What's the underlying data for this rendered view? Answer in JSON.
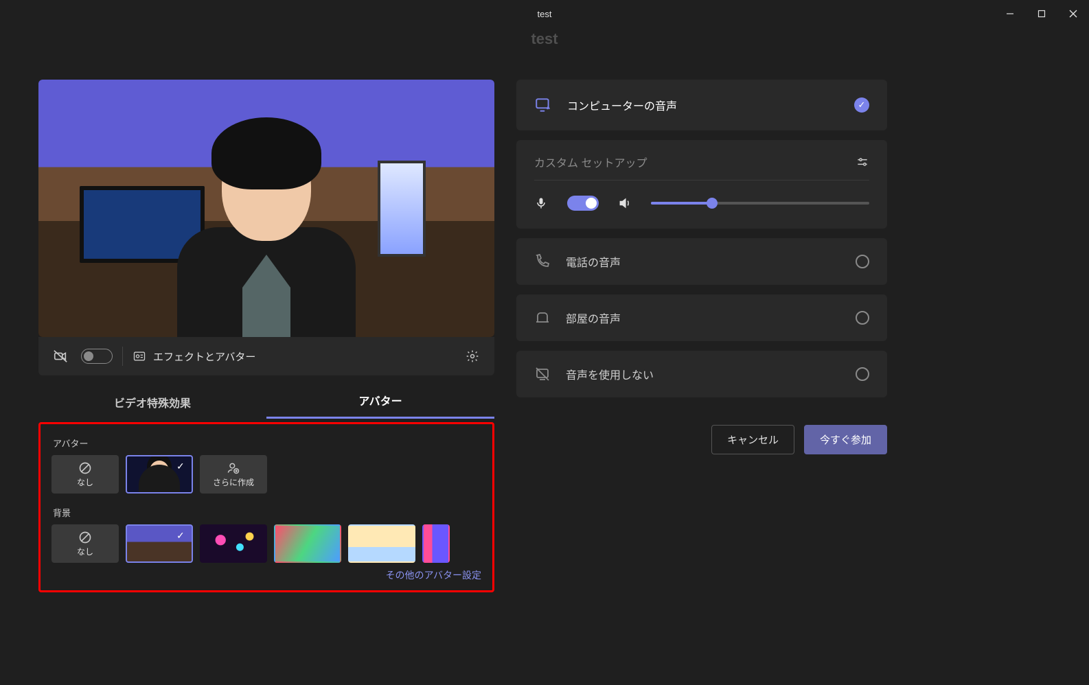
{
  "window": {
    "title": "test"
  },
  "meeting": {
    "name": "test"
  },
  "previewBar": {
    "effectsLabel": "エフェクトとアバター"
  },
  "tabs": {
    "videoEffects": "ビデオ特殊効果",
    "avatar": "アバター"
  },
  "avatarPanel": {
    "avatarSection": "アバター",
    "noneLabel": "なし",
    "moreCreate": "さらに作成",
    "backgroundSection": "背景",
    "bgNoneLabel": "なし",
    "moreSettings": "その他のアバター設定"
  },
  "audio": {
    "computer": "コンピューターの音声",
    "customSetup": "カスタム セットアップ",
    "phone": "電話の音声",
    "room": "部屋の音声",
    "none": "音声を使用しない"
  },
  "actions": {
    "cancel": "キャンセル",
    "joinNow": "今すぐ参加"
  }
}
